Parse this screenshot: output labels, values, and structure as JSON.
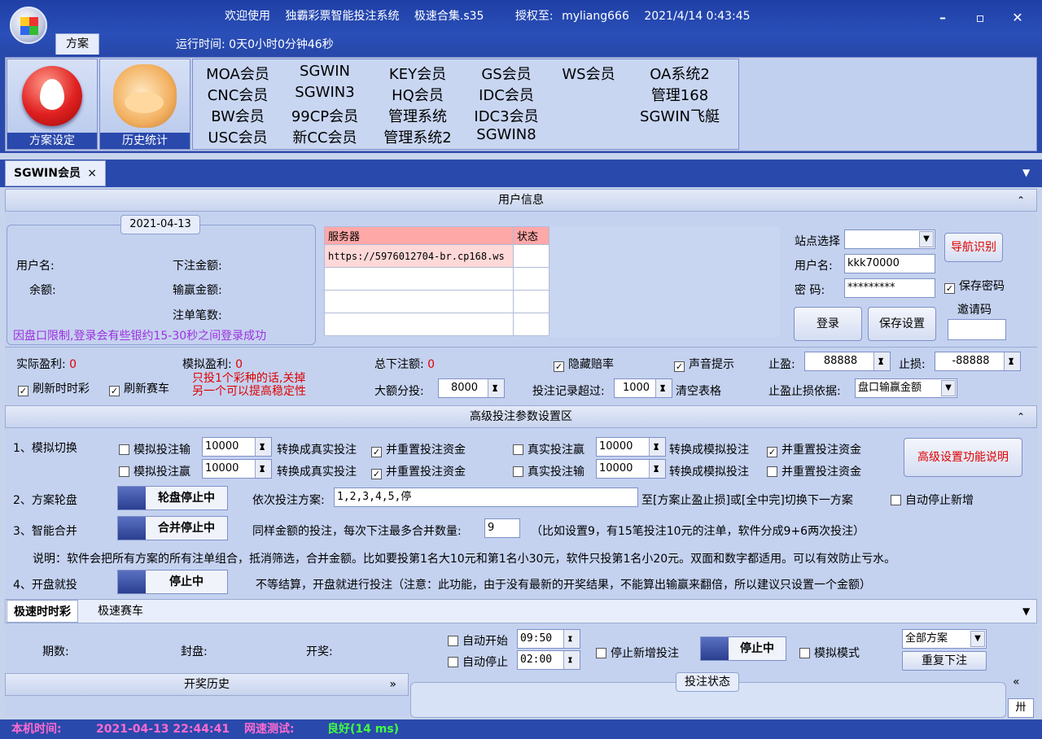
{
  "titlebar": {
    "welcome": "欢迎使用",
    "app_name": "独霸彩票智能投注系统",
    "edition": "极速合集.s35",
    "license_label": "授权至:",
    "license_user": "myliang666",
    "datetime": "2021/4/14  0:43:45",
    "min": "–",
    "max": "▫",
    "close": "✕"
  },
  "top_tab": "方案",
  "runtime": "运行时间: 0天0小时0分钟46秒",
  "ribbon": {
    "btn_plan": "方案设定",
    "btn_history": "历史统计"
  },
  "sites": {
    "c1": [
      "MOA会员",
      "CNC会员",
      "BW会员",
      "USC会员"
    ],
    "c2": [
      "SGWIN",
      "SGWIN3",
      "99CP会员",
      "新CC会员"
    ],
    "c3": [
      "KEY会员",
      "HQ会员",
      "管理系统",
      "管理系统2"
    ],
    "c4": [
      "GS会员",
      "IDC会员",
      "IDC3会员",
      "SGWIN8"
    ],
    "c5": [
      "WS会员"
    ],
    "c6": [
      "OA系统2",
      "管理168",
      "SGWIN飞艇"
    ]
  },
  "doc_tab": {
    "label": "SGWIN会员",
    "close": "×",
    "menu": "▼"
  },
  "user_info": {
    "header": "用户信息",
    "collapse": "⌃",
    "date": "2021-04-13",
    "username_label": "用户名:",
    "balance_label": "余额:",
    "bet_amount_label": "下注金额:",
    "winloss_label": "输赢金额:",
    "bet_count_label": "注单笔数:",
    "note": "因盘口限制,登录会有些银约15-30秒之间登录成功",
    "server_col": "服务器",
    "status_col": "状态",
    "server_url": "https://5976012704-br.cp168.ws",
    "site_select_label": "站点选择",
    "nav_detect": "导航识别",
    "user_label": "用户名:",
    "user_value": "kkk70000",
    "pwd_label": "密  码:",
    "pwd_value": "*********",
    "save_pwd": "保存密码",
    "invite_label": "邀请码",
    "login": "登录",
    "save_settings": "保存设置"
  },
  "stats": {
    "real_profit_label": "实际盈利:",
    "real_profit": "0",
    "sim_profit_label": "模拟盈利:",
    "sim_profit": "0",
    "total_bet_label": "总下注额:",
    "total_bet": "0",
    "hide_odds": "隐藏赔率",
    "sound": "声音提示",
    "take_profit_label": "止盈:",
    "take_profit": "88888",
    "stop_loss_label": "止损:",
    "stop_loss": "-88888",
    "refresh_ssc": "刷新时时彩",
    "refresh_race": "刷新赛车",
    "tip_line1": "只投1个彩种的话,关掉",
    "tip_line2": "另一个可以提高稳定性",
    "big_split_label": "大额分投:",
    "big_split": "8000",
    "record_label": "投注记录超过:",
    "record_value": "1000",
    "clear_table": "清空表格",
    "basis_label": "止盈止损依据:",
    "basis_value": "盘口输赢金额"
  },
  "advanced": {
    "header": "高级投注参数设置区",
    "collapse": "⌃",
    "r1_label": "1、模拟切换",
    "sim_lose": "模拟投注输",
    "sim_win": "模拟投注赢",
    "v10000": "10000",
    "to_real": "转换成真实投注",
    "reset_funds": "并重置投注资金",
    "real_win": "真实投注赢",
    "real_lose": "真实投注输",
    "to_sim": "转换成模拟投注",
    "help_btn": "高级设置功能说明",
    "r2_label": "2、方案轮盘",
    "rotate_btn": "轮盘停止中",
    "seq_label": "依次投注方案:",
    "seq_value": "1,2,3,4,5,停",
    "seq_tail": "至[方案止盈止损]或[全中完]切换下一方案",
    "auto_stop_new": "自动停止新增",
    "r3_label": "3、智能合并",
    "merge_btn": "合并停止中",
    "merge_desc": "同样金额的投注，每次下注最多合并数量:",
    "merge_value": "9",
    "merge_example": "（比如设置9，有15笔投注10元的注单，软件分成9+6两次投注）",
    "explain": "说明：软件会把所有方案的所有注单组合，抵消筛选，合并金额。比如要投第1名大10元和第1名小30元，软件只投第1名小20元。双面和数字都适用。可以有效防止亏水。",
    "r4_label": "4、开盘就投",
    "open_btn": "停止中",
    "open_desc": "不等结算，开盘就进行投注（注意：此功能，由于没有最新的开奖结果，不能算出输赢来翻倍，所以建议只设置一个金额）"
  },
  "lottery_tabs": {
    "ssc": "极速时时彩",
    "race": "极速赛车",
    "menu": "▼"
  },
  "draw": {
    "period_label": "期数:",
    "close_label": "封盘:",
    "draw_label": "开奖:",
    "auto_start": "自动开始",
    "auto_start_time": "09:50",
    "auto_stop": "自动停止",
    "auto_stop_time": "02:00",
    "stop_new_bets": "停止新增投注",
    "state_btn": "停止中",
    "sim_mode": "模拟模式",
    "plan_select": "全部方案",
    "repeat_bet": "重复下注"
  },
  "history": {
    "label": "开奖历史",
    "expand": "»",
    "bet_status": "投注状态",
    "collapse": "«",
    "grid_icon": "卅"
  },
  "status": {
    "local_time_label": "本机时间:",
    "local_time": "2021-04-13 22:44:41",
    "net_label": "网速测试:",
    "net_value": "良好(14 ms)"
  }
}
